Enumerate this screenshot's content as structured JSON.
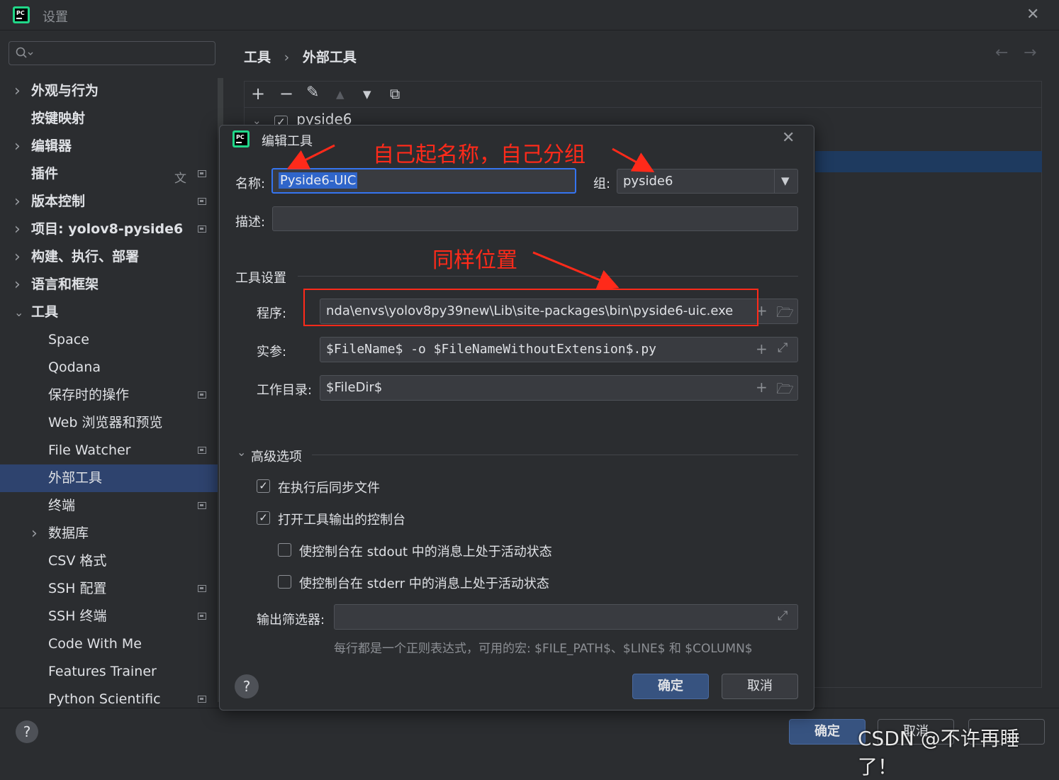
{
  "window": {
    "title": "设置",
    "close_glyph": "✕"
  },
  "search": {
    "placeholder": ""
  },
  "sidebar": {
    "items": [
      {
        "label": "外观与行为",
        "expandable": true,
        "pinned": false,
        "level": 0
      },
      {
        "label": "按键映射",
        "expandable": false,
        "pinned": false,
        "level": 0
      },
      {
        "label": "编辑器",
        "expandable": true,
        "pinned": false,
        "level": 0
      },
      {
        "label": "插件",
        "expandable": false,
        "pinned": true,
        "level": 0,
        "translate_icon": true
      },
      {
        "label": "版本控制",
        "expandable": true,
        "pinned": true,
        "level": 0
      },
      {
        "label": "项目: yolov8-pyside6",
        "expandable": true,
        "pinned": true,
        "level": 0
      },
      {
        "label": "构建、执行、部署",
        "expandable": true,
        "pinned": false,
        "level": 0
      },
      {
        "label": "语言和框架",
        "expandable": true,
        "pinned": false,
        "level": 0
      },
      {
        "label": "工具",
        "expandable": true,
        "expanded": true,
        "pinned": false,
        "level": 0
      },
      {
        "label": "Space",
        "expandable": false,
        "pinned": false,
        "level": 1
      },
      {
        "label": "Qodana",
        "expandable": false,
        "pinned": false,
        "level": 1
      },
      {
        "label": "保存时的操作",
        "expandable": false,
        "pinned": true,
        "level": 1
      },
      {
        "label": "Web 浏览器和预览",
        "expandable": false,
        "pinned": false,
        "level": 1
      },
      {
        "label": "File Watcher",
        "expandable": false,
        "pinned": true,
        "level": 1
      },
      {
        "label": "外部工具",
        "expandable": false,
        "pinned": false,
        "level": 1,
        "active": true
      },
      {
        "label": "终端",
        "expandable": false,
        "pinned": true,
        "level": 1
      },
      {
        "label": "数据库",
        "expandable": true,
        "pinned": false,
        "level": 1
      },
      {
        "label": "CSV 格式",
        "expandable": false,
        "pinned": false,
        "level": 1
      },
      {
        "label": "SSH 配置",
        "expandable": false,
        "pinned": true,
        "level": 1
      },
      {
        "label": "SSH 终端",
        "expandable": false,
        "pinned": true,
        "level": 1
      },
      {
        "label": "Code With Me",
        "expandable": false,
        "pinned": false,
        "level": 1
      },
      {
        "label": "Features Trainer",
        "expandable": false,
        "pinned": false,
        "level": 1
      },
      {
        "label": "Python Scientific",
        "expandable": false,
        "pinned": true,
        "level": 1
      }
    ]
  },
  "main": {
    "breadcrumb": [
      "工具",
      "外部工具"
    ],
    "breadcrumb_sep": "›",
    "toolbar": {
      "add": "+",
      "remove": "−",
      "edit": "✎",
      "up": "▲",
      "down": "▼",
      "copy": "⧉"
    },
    "tree": {
      "group_label": "pyside6",
      "checked": true
    }
  },
  "dialog": {
    "title": "编辑工具",
    "name_label": "名称:",
    "name_value": "Pyside6-UIC",
    "group_label": "组:",
    "group_value": "pyside6",
    "desc_label": "描述:",
    "desc_value": "",
    "tool_settings_label": "工具设置",
    "program_label": "程序:",
    "program_value": "nda\\envs\\yolov8py39new\\Lib\\site-packages\\bin\\pyside6-uic.exe",
    "args_label": "实参:",
    "args_value": "$FileName$ -o $FileNameWithoutExtension$.py",
    "workdir_label": "工作目录:",
    "workdir_value": "$FileDir$",
    "advanced_label": "高级选项",
    "sync_files_label": "在执行后同步文件",
    "sync_files_checked": true,
    "open_console_label": "打开工具输出的控制台",
    "open_console_checked": true,
    "stdout_label": "使控制台在 stdout 中的消息上处于活动状态",
    "stdout_checked": false,
    "stderr_label": "使控制台在 stderr 中的消息上处于活动状态",
    "stderr_checked": false,
    "filter_label": "输出筛选器:",
    "filter_value": "",
    "filter_hint": "每行都是一个正则表达式，可用的宏: $FILE_PATH$、$LINE$ 和 $COLUMN$",
    "ok_label": "确定",
    "cancel_label": "取消",
    "help_label": "?"
  },
  "footer": {
    "ok_label": "确定",
    "cancel_label": "取消",
    "help_label": "?"
  },
  "annotations": {
    "name_group_note": "自己起名称，自己分组",
    "same_location_note": "同样位置"
  },
  "watermark": "CSDN @不许再睡了！",
  "colors": {
    "accent": "#3574f0",
    "annotation": "#ff2a1a",
    "selection": "#2e436e",
    "primary_button": "#375380"
  }
}
